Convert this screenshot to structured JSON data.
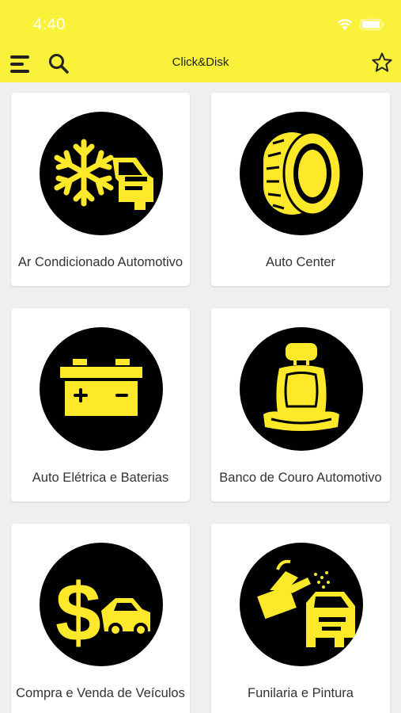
{
  "status_bar": {
    "time": "4:40"
  },
  "app_bar": {
    "title": "Click&Disk",
    "icons": {
      "menu": "menu-icon",
      "search": "search-icon",
      "favorite": "star-outline-icon"
    }
  },
  "colors": {
    "accent": "#faf23a",
    "icon_yellow": "#fde929",
    "card_bg": "#ffffff",
    "page_bg": "#efefef"
  },
  "categories": [
    {
      "label": "Ar Condicionado Automotivo",
      "icon": "snowflake-car-icon"
    },
    {
      "label": "Auto Center",
      "icon": "tire-icon"
    },
    {
      "label": "Auto Elétrica e Baterias",
      "icon": "battery-icon"
    },
    {
      "label": "Banco de Couro Automotivo",
      "icon": "car-seat-icon"
    },
    {
      "label": "Compra e Venda de Veículos",
      "icon": "dollar-car-icon"
    },
    {
      "label": "Funilaria e Pintura",
      "icon": "spray-gun-car-icon"
    }
  ]
}
